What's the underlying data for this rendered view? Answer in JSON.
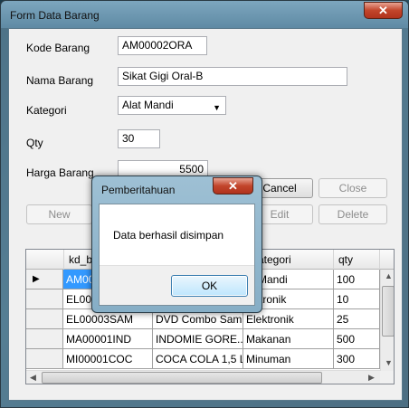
{
  "window": {
    "title": "Form Data Barang",
    "close_glyph": "✕"
  },
  "form": {
    "kode": {
      "label": "Kode Barang",
      "value": "AM00002ORA"
    },
    "nama": {
      "label": "Nama Barang",
      "value": "Sikat Gigi Oral-B"
    },
    "kategori": {
      "label": "Kategori",
      "value": "Alat Mandi",
      "arrow": "▼"
    },
    "qty": {
      "label": "Qty",
      "value": "30"
    },
    "harga": {
      "label": "Harga Barang",
      "value": "5500"
    }
  },
  "buttons": {
    "cancel": "Cancel",
    "close": "Close",
    "new": "New",
    "edit": "Edit",
    "delete": "Delete"
  },
  "grid": {
    "columns": [
      "kd_ba",
      "ategori",
      "qty"
    ],
    "rows": [
      {
        "kd": "AM000",
        "nama": "",
        "kategori": "Mandi",
        "qty": "100",
        "selected": true
      },
      {
        "kd": "EL000",
        "nama": "",
        "kategori": "ktronik",
        "qty": "10"
      },
      {
        "kd": "EL00003SAM",
        "nama": "DVD Combo Sam...",
        "kategori": "Elektronik",
        "qty": "25"
      },
      {
        "kd": "MA00001IND",
        "nama": "INDOMIE GORE...",
        "kategori": "Makanan",
        "qty": "500"
      },
      {
        "kd": "MI00001COC",
        "nama": "COCA COLA 1,5 L",
        "kategori": "Minuman",
        "qty": "300"
      }
    ],
    "row_arrow": "▶",
    "scroll_up": "▲",
    "scroll_down": "▼",
    "scroll_left": "◀",
    "scroll_right": "▶"
  },
  "dialog": {
    "title": "Pemberitahuan",
    "message": "Data berhasil disimpan",
    "ok_label": "OK",
    "close_glyph": "✕"
  }
}
